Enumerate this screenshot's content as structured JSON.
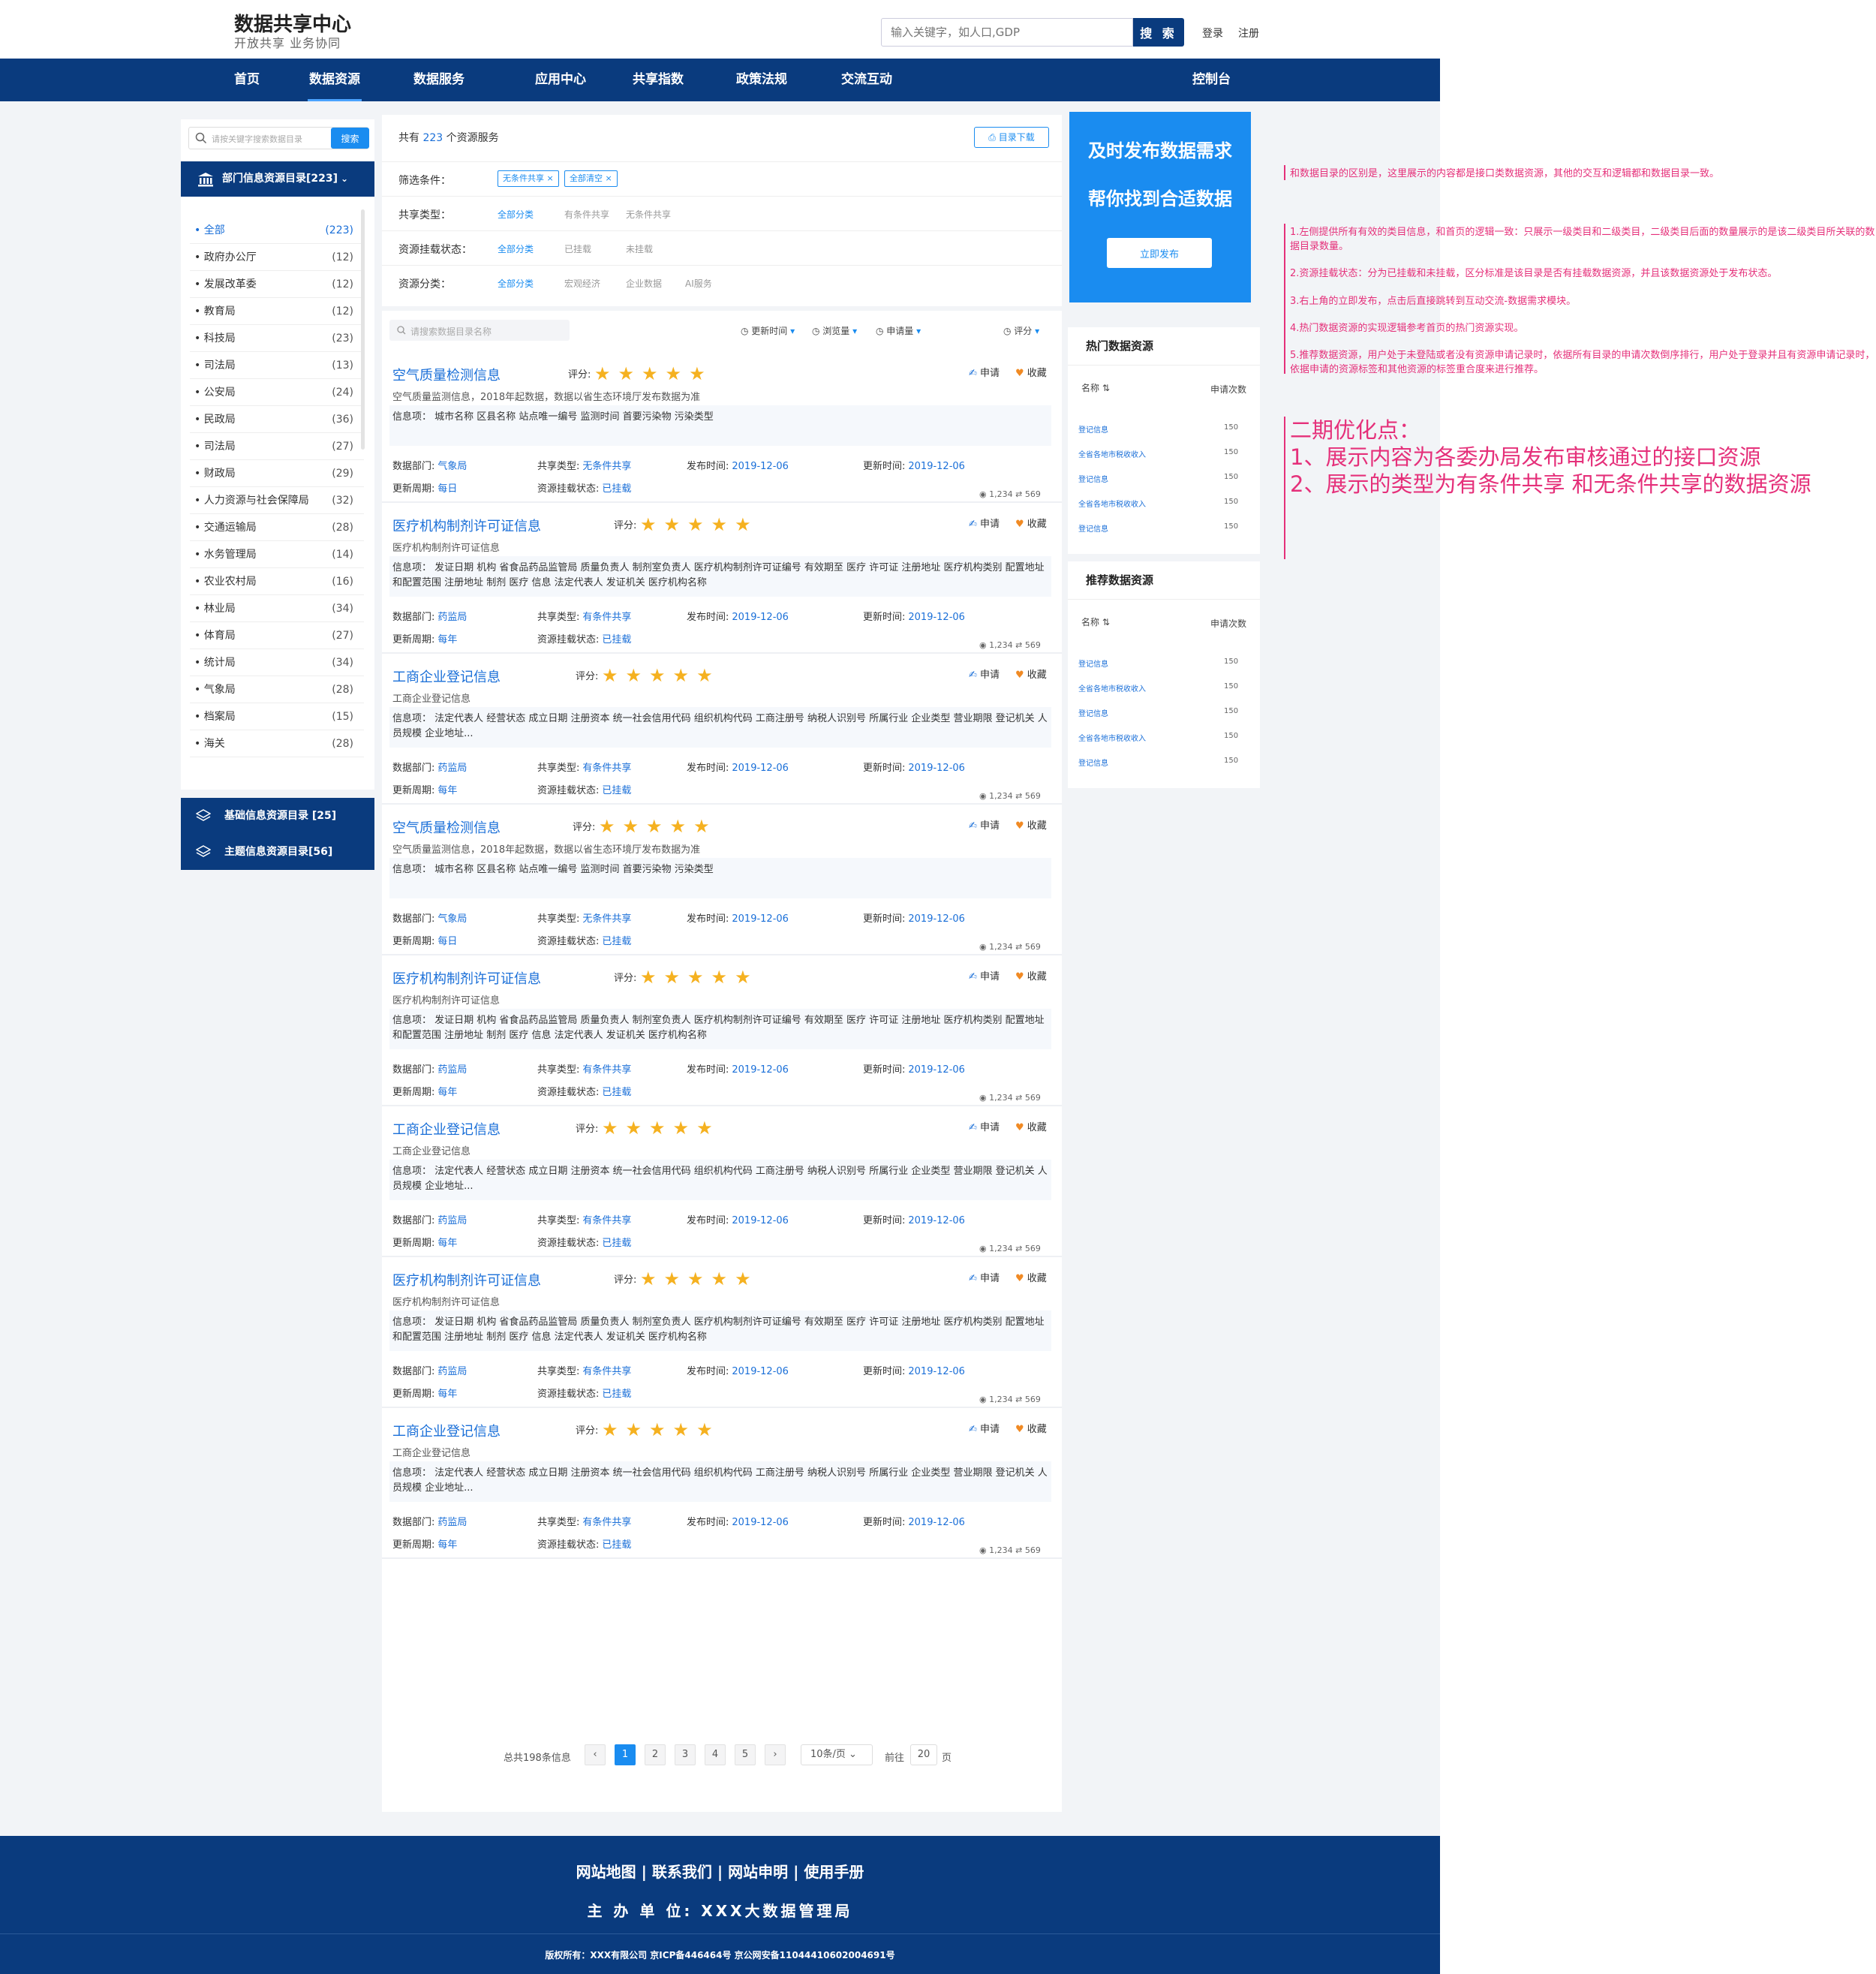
{
  "header": {
    "title": "数据共享中心",
    "subtitle": "开放共享   业务协同",
    "search_placeholder": "输入关键字，如人口,GDP",
    "search_button": "搜 索",
    "login": "登录",
    "register": "注册"
  },
  "nav": [
    "首页",
    "数据资源",
    "数据服务",
    "应用中心",
    "共享指数",
    "政策法规",
    "交流互动",
    "控制台"
  ],
  "sidebar": {
    "search_placeholder": "请按关键字搜索数据目录",
    "search_button": "搜索",
    "category_title": "部门信息资源目录[223]",
    "items": [
      {
        "label": "• 全部",
        "count": "(223)"
      },
      {
        "label": "• 政府办公厅",
        "count": "(12)"
      },
      {
        "label": "• 发展改革委",
        "count": "(12)"
      },
      {
        "label": "• 教育局",
        "count": "(12)"
      },
      {
        "label": "• 科技局",
        "count": "(23)"
      },
      {
        "label": "• 司法局",
        "count": "(13)"
      },
      {
        "label": "• 公安局",
        "count": "(24)"
      },
      {
        "label": "• 民政局",
        "count": "(36)"
      },
      {
        "label": "• 司法局",
        "count": "(27)"
      },
      {
        "label": "• 财政局",
        "count": "(29)"
      },
      {
        "label": "• 人力资源与社会保障局",
        "count": "(32)"
      },
      {
        "label": "• 交通运输局",
        "count": "(28)"
      },
      {
        "label": "• 水务管理局",
        "count": "(14)"
      },
      {
        "label": "• 农业农村局",
        "count": "(16)"
      },
      {
        "label": "• 林业局",
        "count": "(34)"
      },
      {
        "label": "• 体育局",
        "count": "(27)"
      },
      {
        "label": "• 统计局",
        "count": "(34)"
      },
      {
        "label": "• 气象局",
        "count": "(28)"
      },
      {
        "label": "• 档案局",
        "count": "(15)"
      },
      {
        "label": "• 海关",
        "count": "(28)"
      }
    ],
    "base_catalog": "基础信息资源目录 [25]",
    "theme_catalog": "主题信息资源目录[56]"
  },
  "filters": {
    "total_prefix": "共有 ",
    "total_num": "223",
    "total_suffix": " 个资源服务",
    "download": "目录下载",
    "cond_label": "筛选条件：",
    "cond_tags": [
      "无条件共享 ×",
      "全部清空 ×"
    ],
    "share_label": "共享类型：",
    "share_opts": [
      "全部分类",
      "有条件共享",
      "无条件共享"
    ],
    "mount_label": "资源挂载状态：",
    "mount_opts": [
      "全部分类",
      "已挂载",
      "未挂载"
    ],
    "class_label": "资源分类：",
    "class_opts": [
      "全部分类",
      "宏观经济",
      "企业数据",
      "AI服务"
    ]
  },
  "list": {
    "search_placeholder": "请搜索数据目录名称",
    "sorts": [
      "更新时间",
      "浏览量",
      "申请量",
      "评分"
    ],
    "rate_label": "评分:",
    "apply": "申请",
    "fav": "收藏",
    "dept_label": "数据部门:",
    "share_label": "共享类型:",
    "pub_label": "发布时间:",
    "upd_label": "更新时间:",
    "cycle_label": "更新周期:",
    "mount_label": "资源挂载状态:",
    "views": "1,234",
    "applies": "569",
    "cards": [
      {
        "title": "空气质量检测信息",
        "stars": "★★★★★",
        "desc": "空气质量监测信息，2018年起数据，数据以省生态环境厅发布数据为准",
        "info": "信息项： 城市名称  区县名称  站点唯一编号  监测时间  首要污染物  污染类型",
        "dept": "气象局",
        "share": "无条件共享",
        "pub": "2019-12-06",
        "upd": "2019-12-06",
        "cycle": "每日",
        "mount": "已挂载"
      },
      {
        "title": "医疗机构制剂许可证信息",
        "stars": "★★★★★",
        "desc": "医疗机构制剂许可证信息",
        "info": "信息项： 发证日期  机构  省食品药品监管局  质量负责人  制剂室负责人  医疗机构制剂许可证编号  有效期至  医疗  许可证  注册地址  医疗机构类别  配置地址和配置范围  注册地址  制剂  医疗  信息  法定代表人  发证机关  医疗机构名称",
        "dept": "药监局",
        "share": "有条件共享",
        "pub": "2019-12-06",
        "upd": "2019-12-06",
        "cycle": "每年",
        "mount": "已挂载"
      },
      {
        "title": "工商企业登记信息",
        "stars": "★★★★★",
        "desc": "工商企业登记信息",
        "info": "信息项： 法定代表人  经营状态  成立日期  注册资本  统一社会信用代码  组织机构代码  工商注册号  纳税人识别号  所属行业  企业类型  营业期限  登记机关  人员规模  企业地址...",
        "dept": "药监局",
        "share": "有条件共享",
        "pub": "2019-12-06",
        "upd": "2019-12-06",
        "cycle": "每年",
        "mount": "已挂载"
      },
      {
        "title": "空气质量检测信息",
        "stars": "★★★★★",
        "desc": "空气质量监测信息，2018年起数据，数据以省生态环境厅发布数据为准",
        "info": "信息项： 城市名称  区县名称  站点唯一编号  监测时间  首要污染物  污染类型",
        "dept": "气象局",
        "share": "无条件共享",
        "pub": "2019-12-06",
        "upd": "2019-12-06",
        "cycle": "每日",
        "mount": "已挂载"
      },
      {
        "title": "医疗机构制剂许可证信息",
        "stars": "★★★★★",
        "desc": "医疗机构制剂许可证信息",
        "info": "信息项： 发证日期  机构  省食品药品监管局  质量负责人  制剂室负责人  医疗机构制剂许可证编号  有效期至  医疗  许可证  注册地址  医疗机构类别  配置地址和配置范围  注册地址  制剂  医疗  信息  法定代表人  发证机关  医疗机构名称",
        "dept": "药监局",
        "share": "有条件共享",
        "pub": "2019-12-06",
        "upd": "2019-12-06",
        "cycle": "每年",
        "mount": "已挂载"
      },
      {
        "title": "工商企业登记信息",
        "stars": "★★★★★",
        "desc": "工商企业登记信息",
        "info": "信息项： 法定代表人  经营状态  成立日期  注册资本  统一社会信用代码  组织机构代码  工商注册号  纳税人识别号  所属行业  企业类型  营业期限  登记机关  人员规模  企业地址...",
        "dept": "药监局",
        "share": "有条件共享",
        "pub": "2019-12-06",
        "upd": "2019-12-06",
        "cycle": "每年",
        "mount": "已挂载"
      },
      {
        "title": "医疗机构制剂许可证信息",
        "stars": "★★★★★",
        "desc": "医疗机构制剂许可证信息",
        "info": "信息项： 发证日期  机构  省食品药品监管局  质量负责人  制剂室负责人  医疗机构制剂许可证编号  有效期至  医疗  许可证  注册地址  医疗机构类别  配置地址和配置范围  注册地址  制剂  医疗  信息  法定代表人  发证机关  医疗机构名称",
        "dept": "药监局",
        "share": "有条件共享",
        "pub": "2019-12-06",
        "upd": "2019-12-06",
        "cycle": "每年",
        "mount": "已挂载"
      },
      {
        "title": "工商企业登记信息",
        "stars": "★★★★★",
        "desc": "工商企业登记信息",
        "info": "信息项： 法定代表人  经营状态  成立日期  注册资本  统一社会信用代码  组织机构代码  工商注册号  纳税人识别号  所属行业  企业类型  营业期限  登记机关  人员规模  企业地址...",
        "dept": "药监局",
        "share": "有条件共享",
        "pub": "2019-12-06",
        "upd": "2019-12-06",
        "cycle": "每年",
        "mount": "已挂载"
      }
    ]
  },
  "pager": {
    "total": "总共198条信息",
    "prev": "‹",
    "pages": [
      "1",
      "2",
      "3",
      "4",
      "5"
    ],
    "next": "›",
    "per_page": "10条/页 ⌄",
    "goto_label": "前往",
    "goto_value": "20",
    "page_unit": "页"
  },
  "promo": {
    "line1": "及时发布数据需求",
    "line2": "帮你找到合适数据",
    "button": "立即发布"
  },
  "hot": {
    "title": "热门数据资源",
    "col_name": "名称 ⇅",
    "col_count": "申请次数",
    "rows": [
      {
        "name": "登记信息",
        "count": "150"
      },
      {
        "name": "全省各地市税收收入",
        "count": "150"
      },
      {
        "name": "登记信息",
        "count": "150"
      },
      {
        "name": "全省各地市税收收入",
        "count": "150"
      },
      {
        "name": "登记信息",
        "count": "150"
      }
    ]
  },
  "recommend": {
    "title": "推荐数据资源",
    "col_name": "名称 ⇅",
    "col_count": "申请次数",
    "rows": [
      {
        "name": "登记信息",
        "count": "150"
      },
      {
        "name": "全省各地市税收收入",
        "count": "150"
      },
      {
        "name": "登记信息",
        "count": "150"
      },
      {
        "name": "全省各地市税收收入",
        "count": "150"
      },
      {
        "name": "登记信息",
        "count": "150"
      }
    ]
  },
  "annotations": {
    "note1": "和数据目录的区别是，这里展示的内容都是接口类数据资源，其他的交互和逻辑都和数据目录一致。",
    "note2": "1.左侧提供所有有效的类目信息，和首页的逻辑一致：只展示一级类目和二级类目，二级类目后面的数量展示的是该二级类目所关联的数据目录数量。",
    "note3": "2.资源挂载状态：分为已挂载和未挂载，区分标准是该目录是否有挂载数据资源，并且该数据资源处于发布状态。",
    "note4": "3.右上角的立即发布，点击后直接跳转到互动交流-数据需求模块。",
    "note5": "4.热门数据资源的实现逻辑参考首页的热门资源实现。",
    "note6": "5.推荐数据资源，用户处于未登陆或者没有资源申请记录时，依据所有目录的申请次数倒序排行，用户处于登录并且有资源申请记录时，依据申请的资源标签和其他资源的标签重合度来进行推荐。",
    "big1": "二期优化点：",
    "big2": "1、展示内容为各委办局发布审核通过的接口资源",
    "big3": "2、展示的类型为有条件共享 和无条件共享的数据资源"
  },
  "footer": {
    "links": "网站地图  |  联系我们  |  网站申明  |  使用手册",
    "host": "主 办 单 位: XXX大数据管理局",
    "copyright": "版权所有：XXX有限公司 京ICP备446464号 京公网安备11044410602004691号"
  },
  "colors": {
    "primary": "#0a3b7e",
    "accent": "#1a8cf0",
    "star": "#f5b120",
    "annotation": "#e5307a"
  }
}
